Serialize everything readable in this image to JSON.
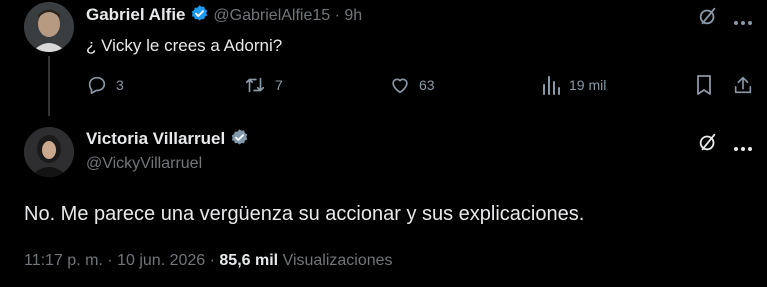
{
  "reply_tweet": {
    "name": "Gabriel Alfie",
    "handle": "@GabrielAlfie15",
    "separator": "·",
    "time": "9h",
    "text": "¿ Vicky le crees a Adorni?",
    "actions": {
      "replies": "3",
      "retweets": "7",
      "likes": "63",
      "views": "19 mil"
    }
  },
  "main_tweet": {
    "name": "Victoria Villarruel",
    "handle": "@VickyVillarruel",
    "text": "No. Me parece una vergüenza su accionar y sus explicaciones.",
    "time": "11:17 p. m.",
    "sep1": "·",
    "date": "10 jun. 2026",
    "sep2": "·",
    "views_count": "85,6 mil",
    "views_label": "Visualizaciones"
  },
  "colors": {
    "background": "#000000",
    "text_primary": "#e7e9ea",
    "text_secondary": "#71767b",
    "verified_blue": "#1d9bf0",
    "verified_gray": "#829aab"
  }
}
